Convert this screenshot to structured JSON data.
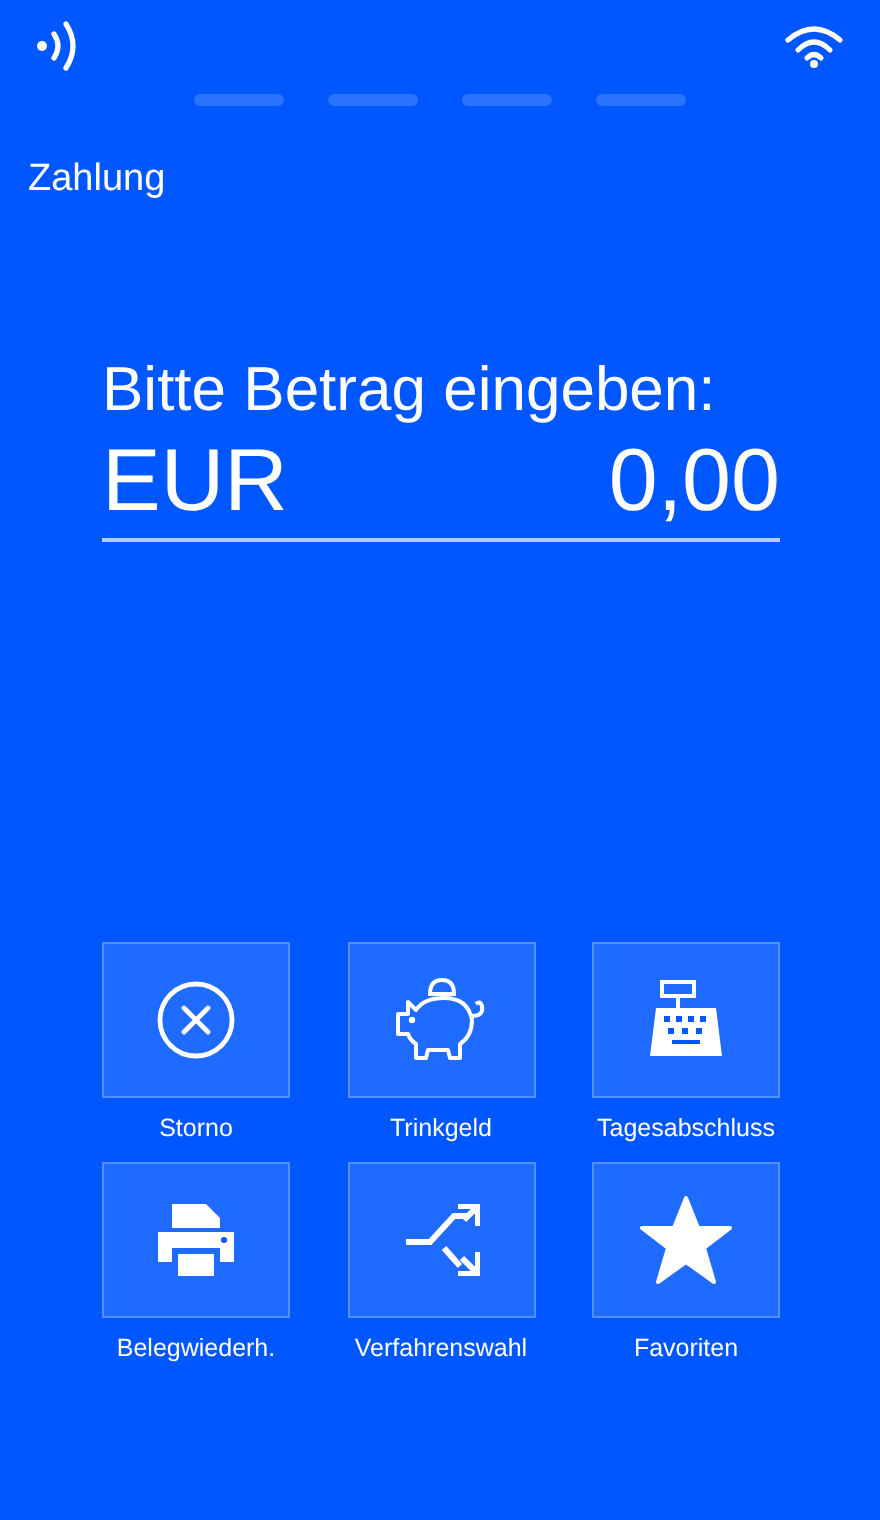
{
  "header": {
    "title": "Zahlung"
  },
  "prompt": "Bitte Betrag eingeben:",
  "amount": {
    "currency": "EUR",
    "value": "0,00"
  },
  "actions": [
    {
      "kind": "cancel",
      "label": "Storno"
    },
    {
      "kind": "tip",
      "label": "Trinkgeld"
    },
    {
      "kind": "register",
      "label": "Tagesabschluss"
    },
    {
      "kind": "print",
      "label": "Belegwiederh."
    },
    {
      "kind": "shuffle",
      "label": "Verfahrenswahl"
    },
    {
      "kind": "star",
      "label": "Favoriten"
    }
  ]
}
